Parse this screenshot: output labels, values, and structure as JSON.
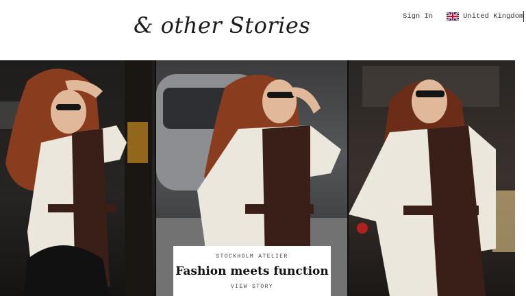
{
  "header": {
    "logo_text": "& other Stories",
    "sign_in_label": "Sign In",
    "region_label": "United Kingdom"
  },
  "hero": {
    "panels": [
      {
        "icon": "model-photo"
      },
      {
        "icon": "model-photo"
      },
      {
        "icon": "model-photo"
      }
    ]
  },
  "story_card": {
    "eyebrow": "STOCKHOLM ATELIER",
    "headline": "Fashion meets function",
    "cta": "VIEW STORY"
  },
  "colors": {
    "dress_dark": "#3a1f18",
    "dress_light": "#ece7dc",
    "hair": "#8a3d1e"
  }
}
